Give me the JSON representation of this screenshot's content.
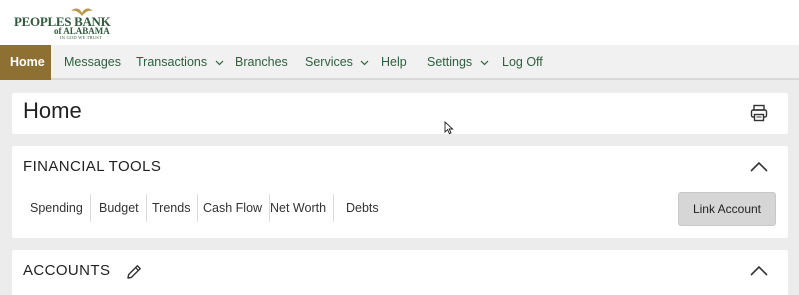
{
  "brand": {
    "name_main": "PEOPLES BANK",
    "name_sub": "of ALABAMA",
    "motto": "IN GOD WE TRUST"
  },
  "nav": {
    "items": [
      {
        "label": "Home",
        "active": true
      },
      {
        "label": "Messages"
      },
      {
        "label": "Transactions",
        "dropdown": true
      },
      {
        "label": "Branches"
      },
      {
        "label": "Services",
        "dropdown": true
      },
      {
        "label": "Help"
      },
      {
        "label": "Settings",
        "dropdown": true
      },
      {
        "label": "Log Off"
      }
    ]
  },
  "home": {
    "title": "Home",
    "print_icon": "printer-icon"
  },
  "financial_tools": {
    "title": "FINANCIAL TOOLS",
    "tabs": [
      "Spending",
      "Budget",
      "Trends",
      "Cash Flow",
      "Net Worth",
      "Debts"
    ],
    "link_button": "Link Account"
  },
  "accounts": {
    "title": "ACCOUNTS",
    "edit_icon": "pencil-icon"
  },
  "colors": {
    "accent": "#8e7032",
    "nav_text": "#2e5e3f",
    "background": "#ececec"
  }
}
